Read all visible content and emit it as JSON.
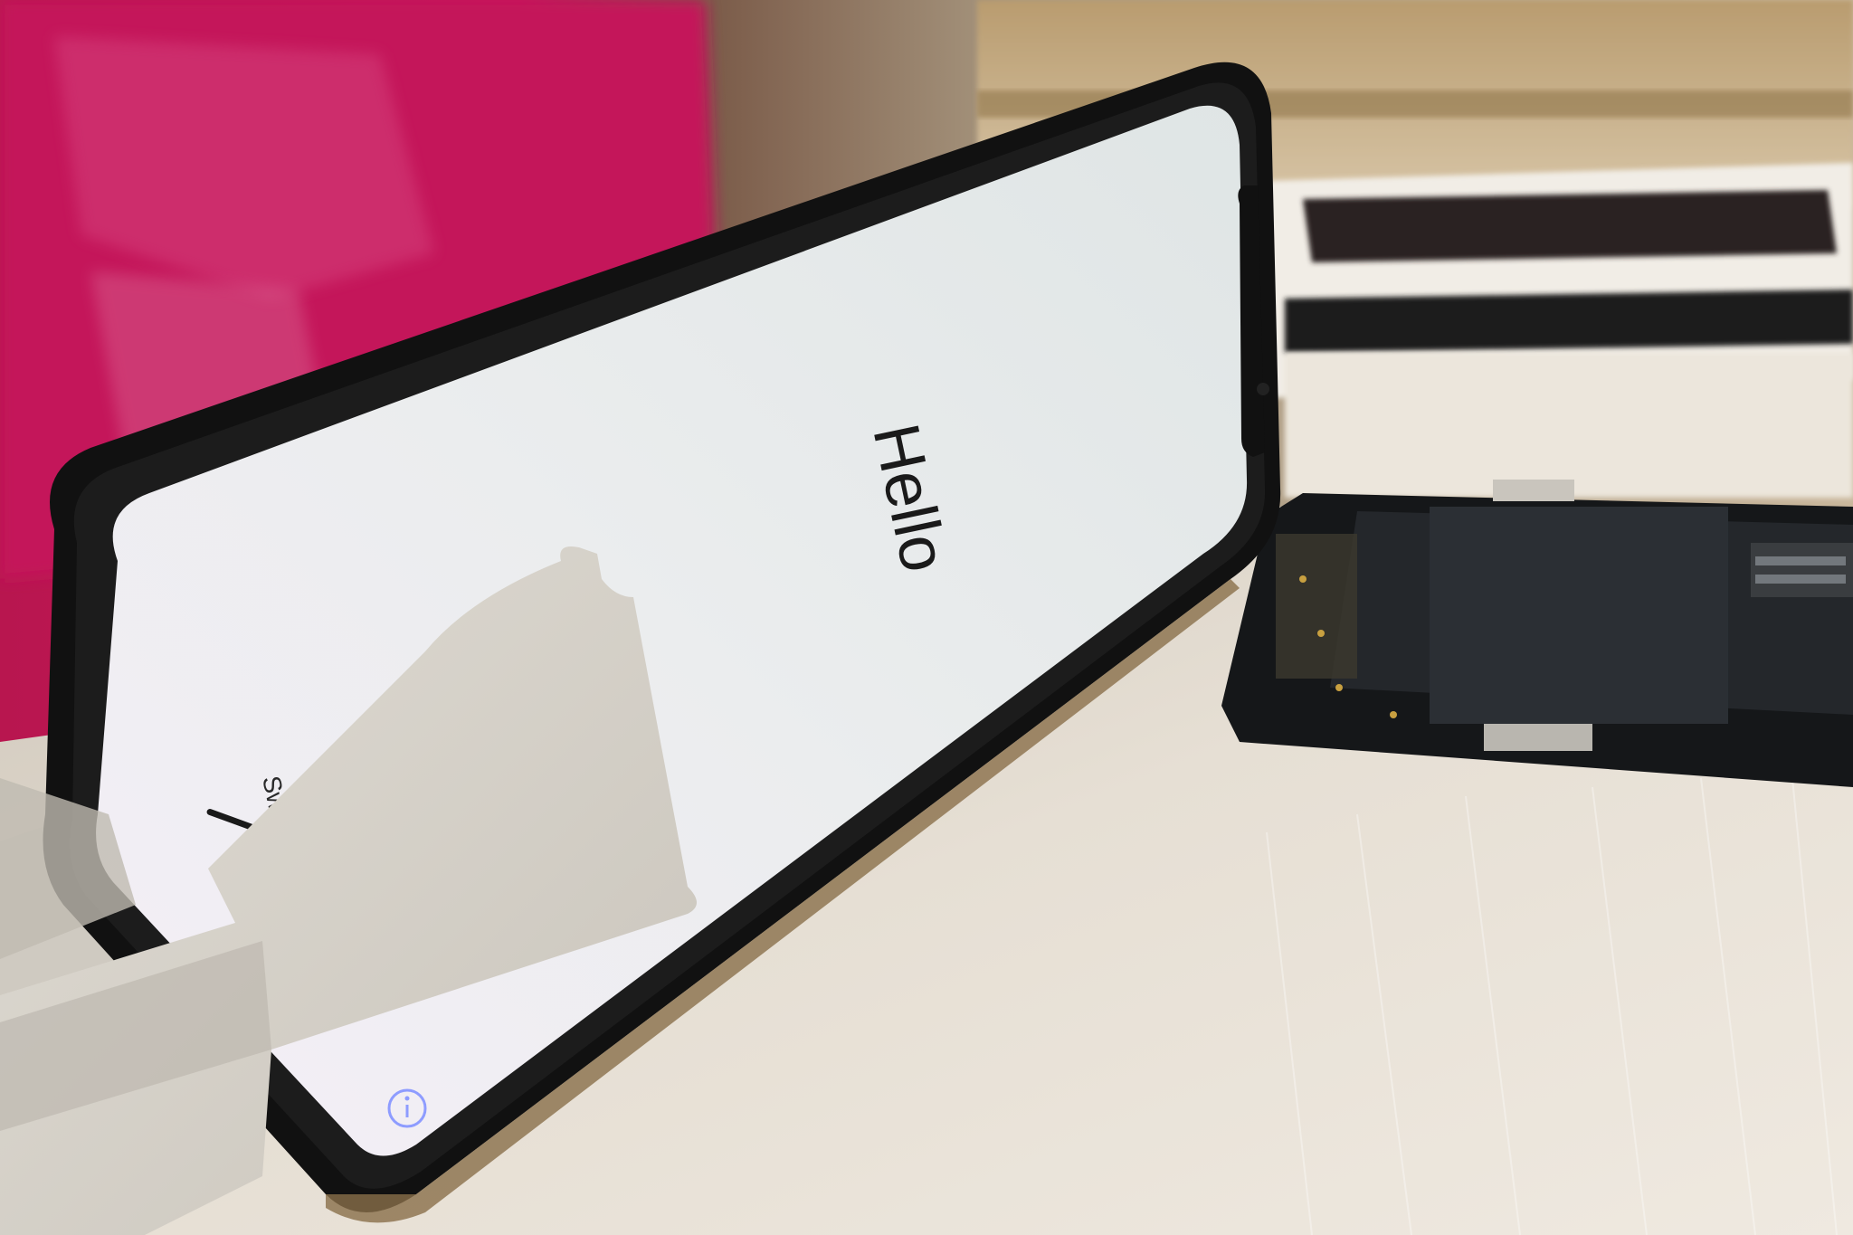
{
  "screen": {
    "greeting": "Hello",
    "hint_partial": "Swi"
  },
  "colors": {
    "pink_background": "#c2185b",
    "phone_frame": "#141414",
    "screen_white": "#eef0f0",
    "table_surface": "#e5ddd2",
    "stand_plastic": "#d4cfc6",
    "info_icon_blue": "#8e9cff",
    "pcb_dark": "#1e2124"
  },
  "icons": [
    "info-icon",
    "home-indicator"
  ]
}
